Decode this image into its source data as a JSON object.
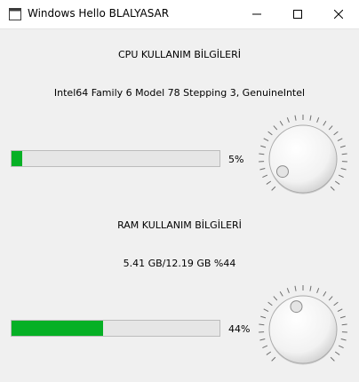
{
  "window": {
    "title": "Windows Hello BLALYASAR"
  },
  "cpu": {
    "heading": "CPU KULLANIM BİLGİLERİ",
    "processor": "Intel64 Family 6 Model 78 Stepping 3, GenuineIntel",
    "usage_percent": 5,
    "usage_label": "5%",
    "dial_value": 5
  },
  "ram": {
    "heading": "RAM KULLANIM BİLGİLERİ",
    "detail": "5.41 GB/12.19 GB %44",
    "usage_percent": 44,
    "usage_label": "44%",
    "dial_value": 44
  },
  "colors": {
    "progress_fill": "#06b025",
    "progress_track": "#e6e6e6",
    "window_bg": "#f0f0f0"
  },
  "icons": {
    "app": "window-icon",
    "minimize": "minimize-icon",
    "maximize": "maximize-icon",
    "close": "close-icon"
  }
}
